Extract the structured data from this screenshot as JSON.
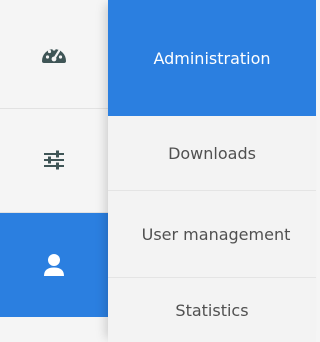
{
  "rail": {
    "items": [
      {
        "icon": "dashboard-icon",
        "active": false
      },
      {
        "icon": "sliders-icon",
        "active": false
      },
      {
        "icon": "user-icon",
        "active": true
      }
    ]
  },
  "menu": {
    "items": [
      {
        "label": "Administration",
        "active": true
      },
      {
        "label": "Downloads",
        "active": false
      },
      {
        "label": "User management",
        "active": false
      },
      {
        "label": "Statistics",
        "active": false
      }
    ]
  },
  "colors": {
    "accent": "#2b7fe0",
    "rail_bg": "#f5f5f5",
    "menu_bg": "#f3f3f3",
    "icon": "#3f5556",
    "text": "#505050"
  }
}
